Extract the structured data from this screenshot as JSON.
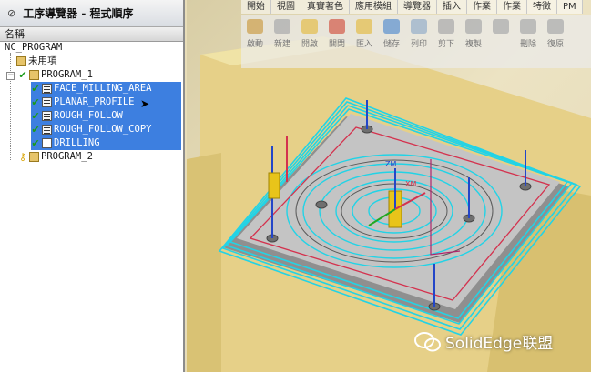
{
  "navigator": {
    "title": "工序導覽器 - 程式順序",
    "column_name": "名稱",
    "items": [
      {
        "label": "NC_PROGRAM"
      },
      {
        "label": "未用項"
      },
      {
        "label": "PROGRAM_1"
      },
      {
        "label": "FACE_MILLING_AREA"
      },
      {
        "label": "PLANAR_PROFILE"
      },
      {
        "label": "ROUGH_FOLLOW"
      },
      {
        "label": "ROUGH_FOLLOW_COPY"
      },
      {
        "label": "DRILLING"
      },
      {
        "label": "PROGRAM_2"
      }
    ]
  },
  "menubar": [
    "開始",
    "視圖",
    "真實著色",
    "應用模組",
    "導覽器",
    "插入",
    "作業",
    "作業",
    "特徵",
    "PM"
  ],
  "toolbar": [
    {
      "label": "啟動",
      "icon": "start-icon"
    },
    {
      "label": "新建",
      "icon": "new-icon"
    },
    {
      "label": "開啟",
      "icon": "open-icon"
    },
    {
      "label": "關閉",
      "icon": "close-icon"
    },
    {
      "label": "匯入",
      "icon": "import-icon"
    },
    {
      "label": "儲存",
      "icon": "save-icon"
    },
    {
      "label": "列印",
      "icon": "print-icon"
    },
    {
      "label": "剪下",
      "icon": "cut-icon"
    },
    {
      "label": "複製",
      "icon": "copy-icon"
    },
    {
      "label": "",
      "icon": "paste-icon"
    },
    {
      "label": "刪除",
      "icon": "delete-icon"
    },
    {
      "label": "復原",
      "icon": "undo-icon"
    }
  ],
  "viewport": {
    "axis_labels": [
      "ZM",
      "XM"
    ]
  },
  "watermark": {
    "text": "SolidEdge联盟"
  },
  "colors": {
    "selection": "#3d7fe0",
    "toolpath": "#22d3e6",
    "check": "#1a9b1a",
    "part_top": "#b9b9b9",
    "fixture": "#e9d27a"
  }
}
